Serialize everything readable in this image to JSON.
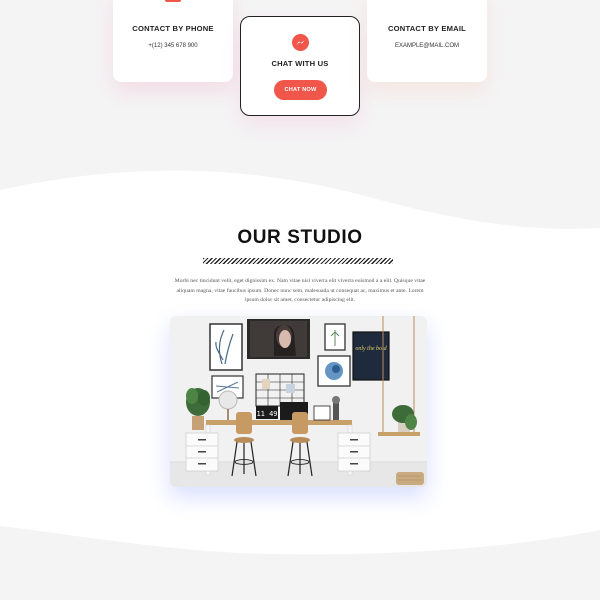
{
  "contact_cards": {
    "phone": {
      "title": "CONTACT BY PHONE",
      "detail": "+(12) 345 678 900",
      "icon": "phone-icon"
    },
    "chat": {
      "title": "CHAT WITH US",
      "button_label": "CHAT NOW",
      "icon": "messenger-icon"
    },
    "email": {
      "title": "CONTACT BY EMAIL",
      "detail": "EXAMPLE@MAIL.COM",
      "icon": "envelope-icon"
    }
  },
  "studio": {
    "title": "OUR STUDIO",
    "intro": "Morbi nec tincidunt velit, eget dignissim ex. Nam vitae nisl viverra elit viverra euismod a a elit. Quisque vitae aliquam magna, vitae faucibus ipsum. Donec nunc sem, malesuada ut consequat ac, maximus et ante. Lorem ipsum dolor sit amet, consectetur adipiscing elit.",
    "clock_text": "11 49",
    "poster_text": "only the bold"
  },
  "colors": {
    "accent": "#f0564a",
    "background": "#f4f4f5",
    "section_background": "#ffffff",
    "text_dark": "#111111"
  }
}
